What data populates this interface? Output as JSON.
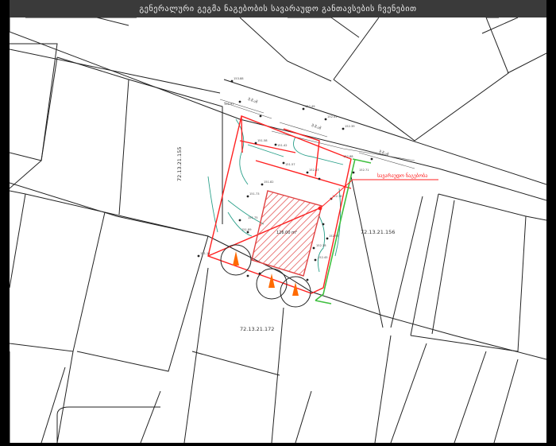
{
  "title": "გენერალური გეგმა ნაგებობის სავარაუდო განთავსების ჩვენებით",
  "parcels": {
    "left": "72.13.21.155",
    "right": "72.13.21.156",
    "bottom": "72.13.21.172"
  },
  "area_label": "126.00 m²",
  "callout_label": "სავარაუდო ნაგებობა",
  "street_labels": [
    "შ.შ.ამ",
    "შ.შ.ამ",
    "შ.შ.ამ"
  ],
  "colors": {
    "boundary": "#ff2020",
    "hatch": "#e04040",
    "contour": "#2aa08a",
    "green": "#3fbf3f",
    "tree": "#ff6a00",
    "lines": "#222222"
  }
}
